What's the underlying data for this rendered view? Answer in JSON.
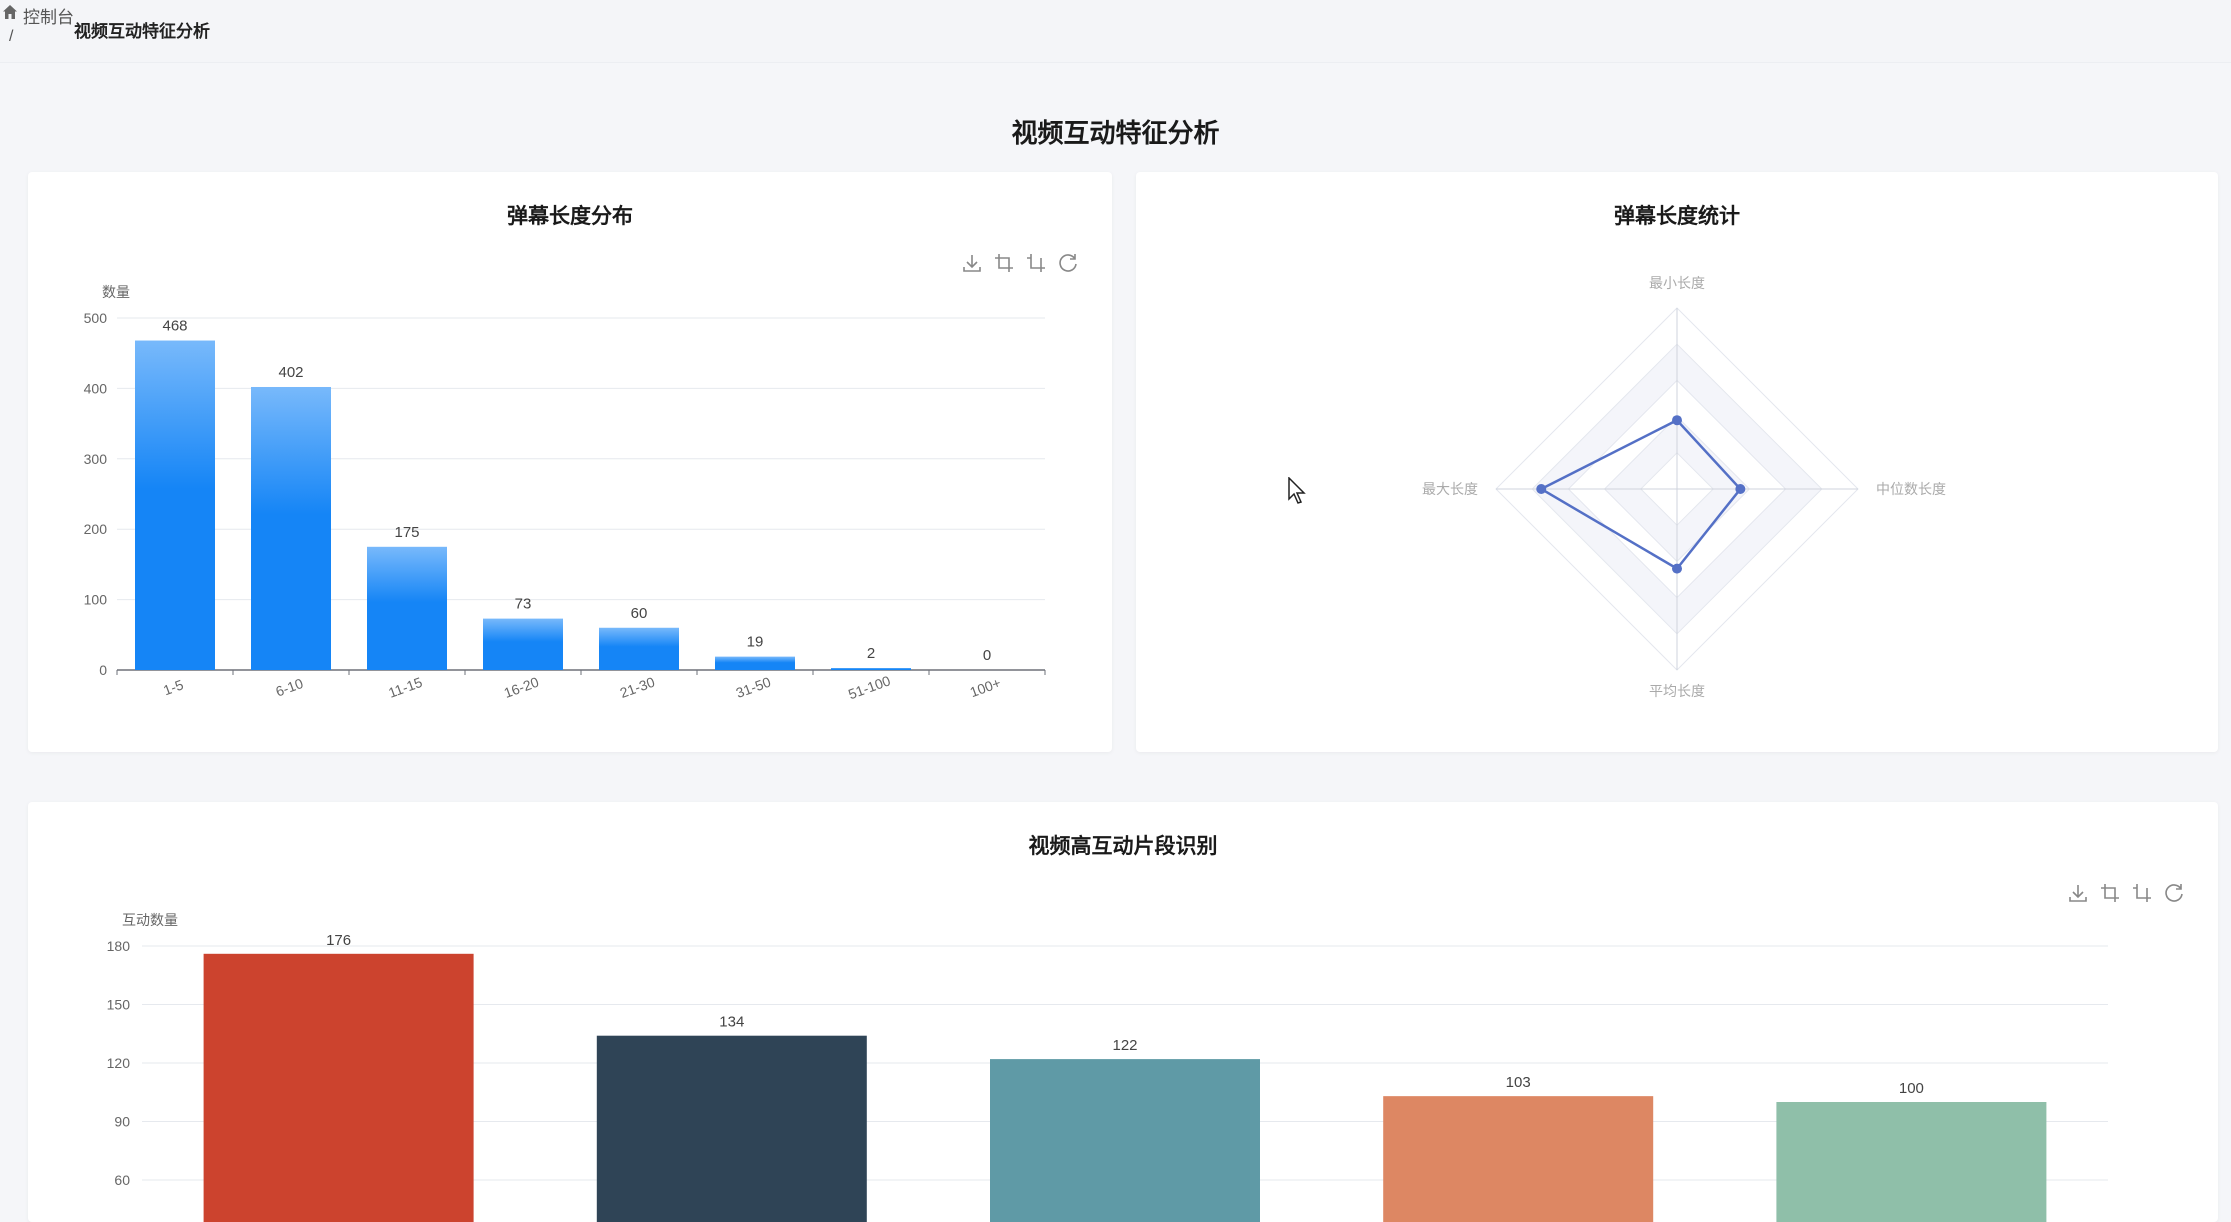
{
  "breadcrumb": {
    "home": "控制台",
    "separator": "/",
    "current": "视频互动特征分析"
  },
  "page_title": "视频互动特征分析",
  "icons": [
    "home-icon",
    "download-icon",
    "zoom-icon",
    "zoom-reset-icon",
    "restore-icon",
    "mouse-cursor-icon"
  ],
  "chart_data": [
    {
      "type": "bar",
      "title": "弹幕长度分布",
      "ylabel": "数量",
      "categories": [
        "1-5",
        "6-10",
        "11-15",
        "16-20",
        "21-30",
        "31-50",
        "51-100",
        "100+"
      ],
      "values": [
        468,
        402,
        175,
        73,
        60,
        19,
        2,
        0
      ],
      "yticks": [
        0,
        100,
        200,
        300,
        400,
        500
      ],
      "ylim": [
        0,
        500
      ],
      "grid": true,
      "colors": {
        "top": "#78b9fb",
        "bottom": "#1585f6"
      }
    },
    {
      "type": "radar",
      "title": "弹幕长度统计",
      "indicators": [
        "最小长度",
        "中位数长度",
        "平均长度",
        "最大长度"
      ],
      "values": [
        0.38,
        0.35,
        0.44,
        0.75
      ],
      "color": "#5470c6"
    },
    {
      "type": "bar",
      "title": "视频高互动片段识别",
      "ylabel": "互动数量",
      "values": [
        176,
        134,
        122,
        103,
        100
      ],
      "yticks": [
        60,
        90,
        120,
        150,
        180
      ],
      "colors": [
        "#cc432e",
        "#2f4456",
        "#5f9aa6",
        "#dd8763",
        "#8fbfa9"
      ],
      "grid": true
    }
  ]
}
